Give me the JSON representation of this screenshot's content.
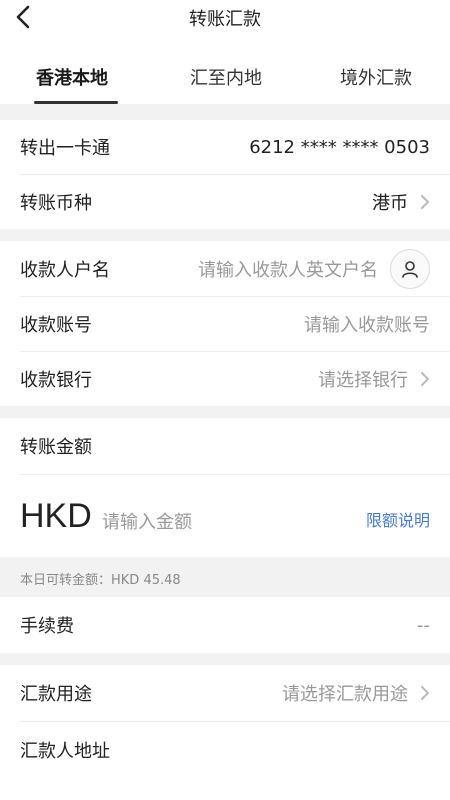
{
  "header": {
    "title": "转账汇款",
    "back_icon": "chevron-left-icon"
  },
  "tabs": [
    {
      "label": "香港本地",
      "active": true
    },
    {
      "label": "汇至内地",
      "active": false
    },
    {
      "label": "境外汇款",
      "active": false
    }
  ],
  "from_account": {
    "label": "转出一卡通",
    "value": "6212 **** **** 0503"
  },
  "currency": {
    "label": "转账币种",
    "value": "港币"
  },
  "payee_name": {
    "label": "收款人户名",
    "placeholder": "请输入收款人英文户名",
    "icon": "contact-person-icon"
  },
  "payee_account": {
    "label": "收款账号",
    "placeholder": "请输入收款账号"
  },
  "payee_bank": {
    "label": "收款银行",
    "placeholder": "请选择银行"
  },
  "amount": {
    "label": "转账金额",
    "currency_code": "HKD",
    "placeholder": "请输入金额",
    "limit_link": "限额说明",
    "daily_limit_text": "本日可转金额：HKD 45.48"
  },
  "fee": {
    "label": "手续费",
    "value": "--"
  },
  "purpose": {
    "label": "汇款用途",
    "placeholder": "请选择汇款用途"
  },
  "remitter_address": {
    "label": "汇款人地址"
  },
  "colors": {
    "link": "#4a7bd1",
    "background_gray": "#f2f2f2",
    "placeholder": "#999999"
  }
}
